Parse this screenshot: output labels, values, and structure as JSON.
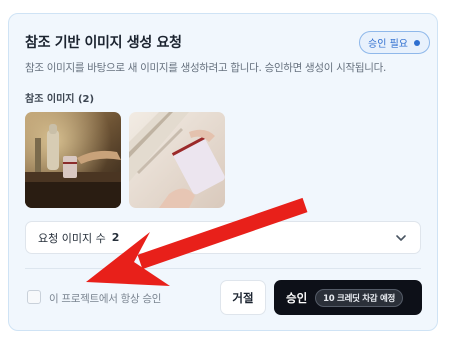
{
  "card": {
    "title": "참조 기반 이미지 생성 요청",
    "badge": "승인 필요",
    "description": "참조 이미지를 바탕으로 새 이미지를 생성하려고 합니다. 승인하면 생성이 시작됩니다.",
    "reference_label": "참조 이미지 (2)"
  },
  "request_count": {
    "label": "요청 이미지 수",
    "value": "2"
  },
  "footer": {
    "always_approve_label": "이 프로젝트에서 항상 승인",
    "reject_label": "거절",
    "approve_label": "승인",
    "credit_label": "10 크레딧 차감 예정"
  },
  "colors": {
    "accent": "#2f6fd0",
    "arrow": "#e8201a",
    "approve_bg": "#0d1018"
  },
  "icons": {
    "chevron": "chevron-down-icon",
    "badge_dot": "status-dot-icon"
  }
}
